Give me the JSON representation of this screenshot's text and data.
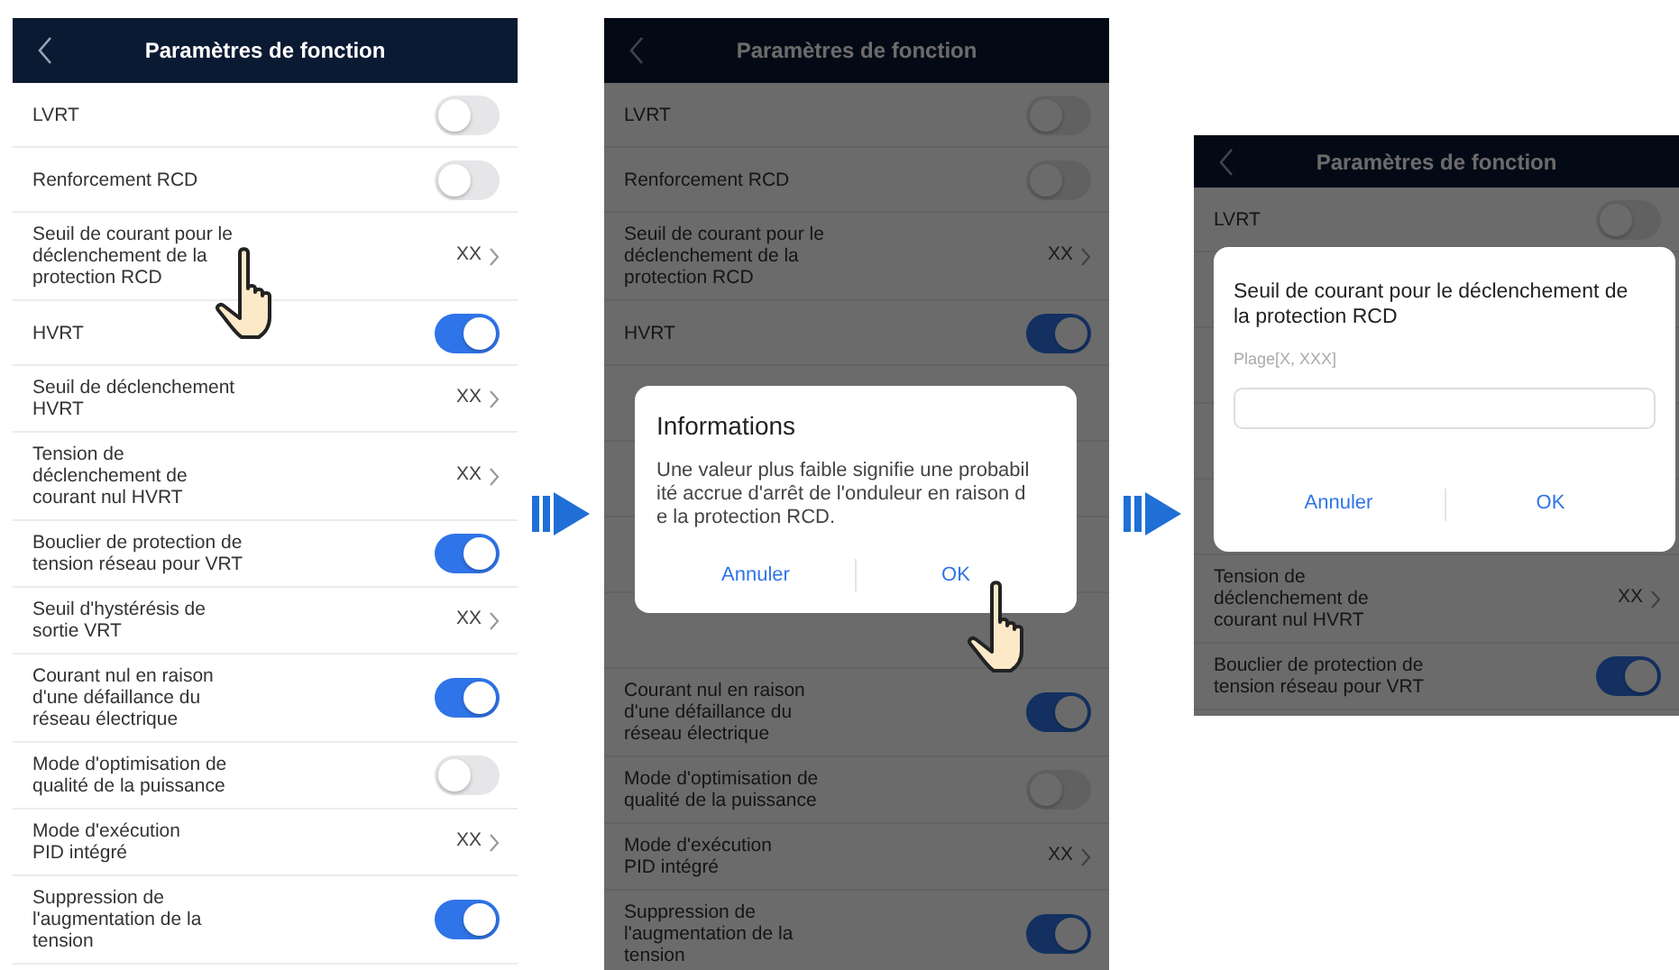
{
  "screens": [
    {
      "title": "Paramètres de fonction",
      "rows": [
        {
          "kind": "toggle",
          "label": "LVRT",
          "on": false
        },
        {
          "kind": "toggle",
          "label": "Renforcement RCD",
          "on": false
        },
        {
          "kind": "value",
          "label": "Seuil de courant pour le\ndéclenchement de la\nprotection RCD",
          "value": "XX",
          "tapped": true
        },
        {
          "kind": "toggle",
          "label": "HVRT",
          "on": true
        },
        {
          "kind": "value",
          "label": "Seuil de déclenchement\nHVRT",
          "value": "XX"
        },
        {
          "kind": "value",
          "label": "Tension de\ndéclenchement de\ncourant nul HVRT",
          "value": "XX"
        },
        {
          "kind": "toggle",
          "label": "Bouclier de protection de\ntension réseau pour VRT",
          "on": true
        },
        {
          "kind": "value",
          "label": "Seuil d'hystérésis de\nsortie VRT",
          "value": "XX"
        },
        {
          "kind": "toggle",
          "label": "Courant nul en raison\nd'une défaillance du\nréseau électrique",
          "on": true
        },
        {
          "kind": "toggle",
          "label": "Mode d'optimisation de\nqualité de la puissance",
          "on": false
        },
        {
          "kind": "value",
          "label": "Mode d'exécution\nPID intégré",
          "value": "XX"
        },
        {
          "kind": "toggle",
          "label": "Suppression de\nl'augmentation de la\ntension",
          "on": true
        }
      ]
    },
    {
      "title": "Paramètres de fonction",
      "rows": [
        {
          "kind": "toggle",
          "label": "LVRT",
          "on": false
        },
        {
          "kind": "toggle",
          "label": "Renforcement RCD",
          "on": false
        },
        {
          "kind": "value",
          "label": "Seuil de courant pour le\ndéclenchement de la\nprotection RCD",
          "value": "XX"
        },
        {
          "kind": "toggle",
          "label": "HVRT",
          "on": true
        },
        {
          "kind": "blank"
        },
        {
          "kind": "blank"
        },
        {
          "kind": "blank"
        },
        {
          "kind": "blank"
        },
        {
          "kind": "toggle",
          "label": "Courant nul en raison\nd'une défaillance du\nréseau électrique",
          "on": true
        },
        {
          "kind": "toggle",
          "label": "Mode d'optimisation de\nqualité de la puissance",
          "on": false
        },
        {
          "kind": "value",
          "label": "Mode d'exécution\nPID intégré",
          "value": "XX"
        },
        {
          "kind": "toggle",
          "label": "Suppression de\nl'augmentation de la\ntension",
          "on": true
        }
      ],
      "dialog": {
        "kind": "message",
        "title": "Informations",
        "message": "Une valeur plus faible signifie une probabilité accrue d'arrêt de l'onduleur en raison de la protection RCD.",
        "buttons": [
          {
            "label": "Annuler",
            "tapped": false
          },
          {
            "label": "OK",
            "tapped": true
          }
        ]
      }
    },
    {
      "title": "Paramètres de fonction",
      "rows": [
        {
          "kind": "toggle",
          "label": "LVRT",
          "on": false
        },
        {
          "kind": "blank"
        },
        {
          "kind": "blank"
        },
        {
          "kind": "blank"
        },
        {
          "kind": "blank"
        },
        {
          "kind": "value",
          "label": "Tension de\ndéclenchement de\ncourant nul HVRT",
          "value": "XX"
        },
        {
          "kind": "toggle",
          "label": "Bouclier de protection de\ntension réseau pour VRT",
          "on": true
        }
      ],
      "dialog": {
        "kind": "input",
        "title": "Seuil de courant pour le déclenchement de la protection RCD",
        "range_label": "Plage[X, XXX]",
        "buttons": [
          {
            "label": "Annuler",
            "tapped": false
          },
          {
            "label": "OK",
            "tapped": false
          }
        ]
      }
    }
  ]
}
